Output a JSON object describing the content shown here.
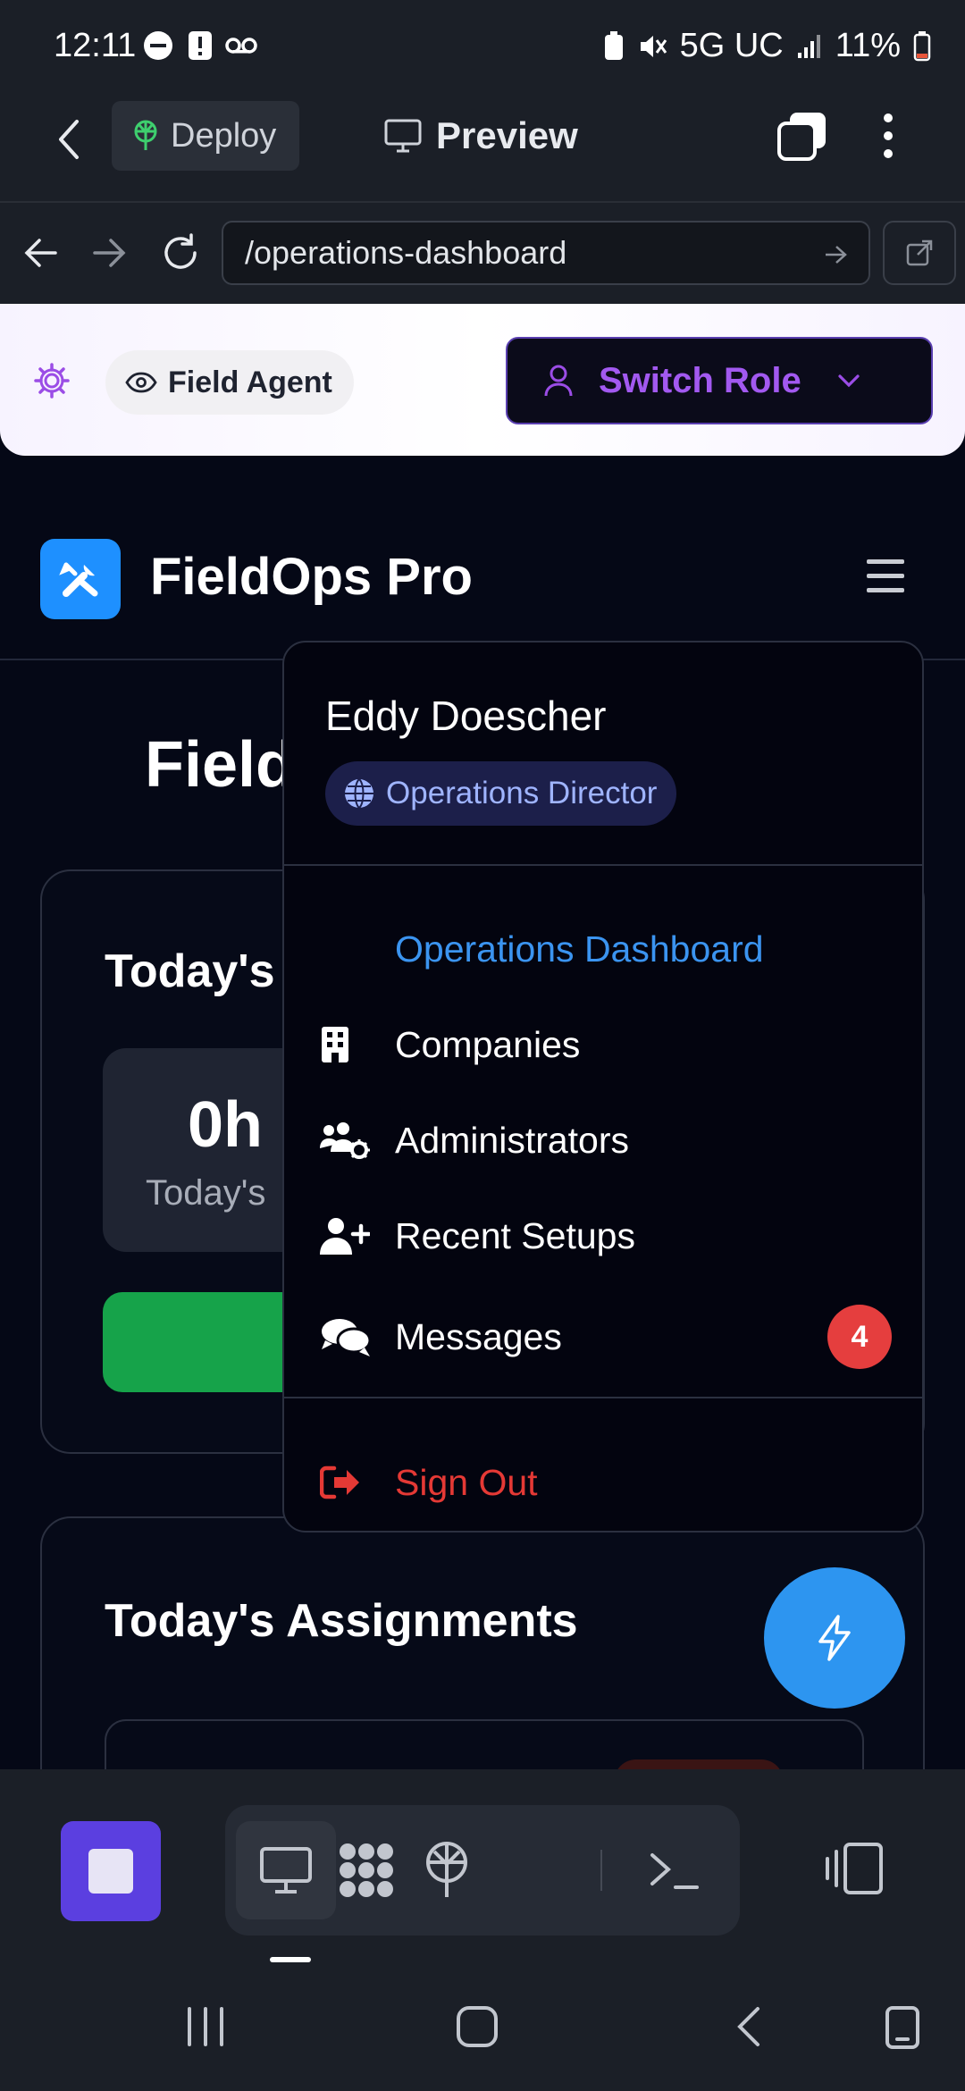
{
  "status_bar": {
    "time": "12:11",
    "network": "5G UC",
    "battery": "11%"
  },
  "app_bar": {
    "deploy_label": "Deploy",
    "preview_label": "Preview"
  },
  "url_bar": {
    "url": "/operations-dashboard"
  },
  "role_bar": {
    "current_role": "Field Agent",
    "switch_label": "Switch Role"
  },
  "header": {
    "brand": "FieldOps Pro"
  },
  "page": {
    "title_partial": "Field",
    "card1_title": "Today's T",
    "stat_value": "0h",
    "stat_label": "Today's",
    "card2_title": "Today's Assignments"
  },
  "menu": {
    "user_name": "Eddy Doescher",
    "user_role": "Operations Director",
    "items": [
      {
        "label": "Operations Dashboard",
        "icon": "none",
        "active": true
      },
      {
        "label": "Companies",
        "icon": "building-icon"
      },
      {
        "label": "Administrators",
        "icon": "users-cog-icon"
      },
      {
        "label": "Recent Setups",
        "icon": "user-plus-icon"
      },
      {
        "label": "Messages",
        "icon": "comments-icon",
        "badge": "4"
      }
    ],
    "sign_out": "Sign Out"
  },
  "colors": {
    "accent_blue": "#2d95f0",
    "purple": "#a259f0",
    "danger": "#e53935",
    "success": "#16a34a"
  }
}
